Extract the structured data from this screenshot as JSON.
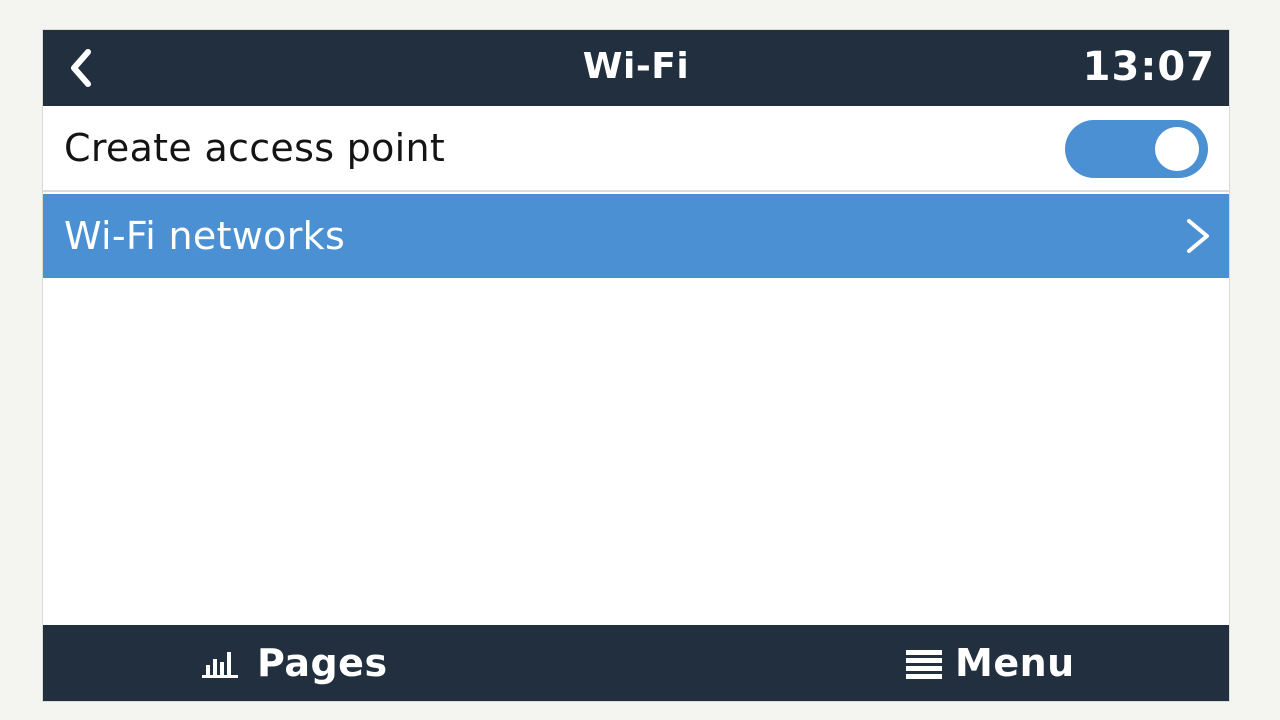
{
  "header": {
    "back_icon": "chevron-left-icon",
    "title": "Wi-Fi",
    "clock": "13:07"
  },
  "settings": {
    "access_point": {
      "label": "Create access point",
      "enabled": true
    },
    "wifi_networks": {
      "label": "Wi-Fi networks",
      "icon": "chevron-right-icon"
    }
  },
  "footer": {
    "pages_label": "Pages",
    "pages_icon": "bar-chart-icon",
    "menu_label": "Menu",
    "menu_icon": "hamburger-menu-icon"
  },
  "colors": {
    "header_bg": "#222f3e",
    "accent": "#4a90d2",
    "text": "#141414"
  }
}
